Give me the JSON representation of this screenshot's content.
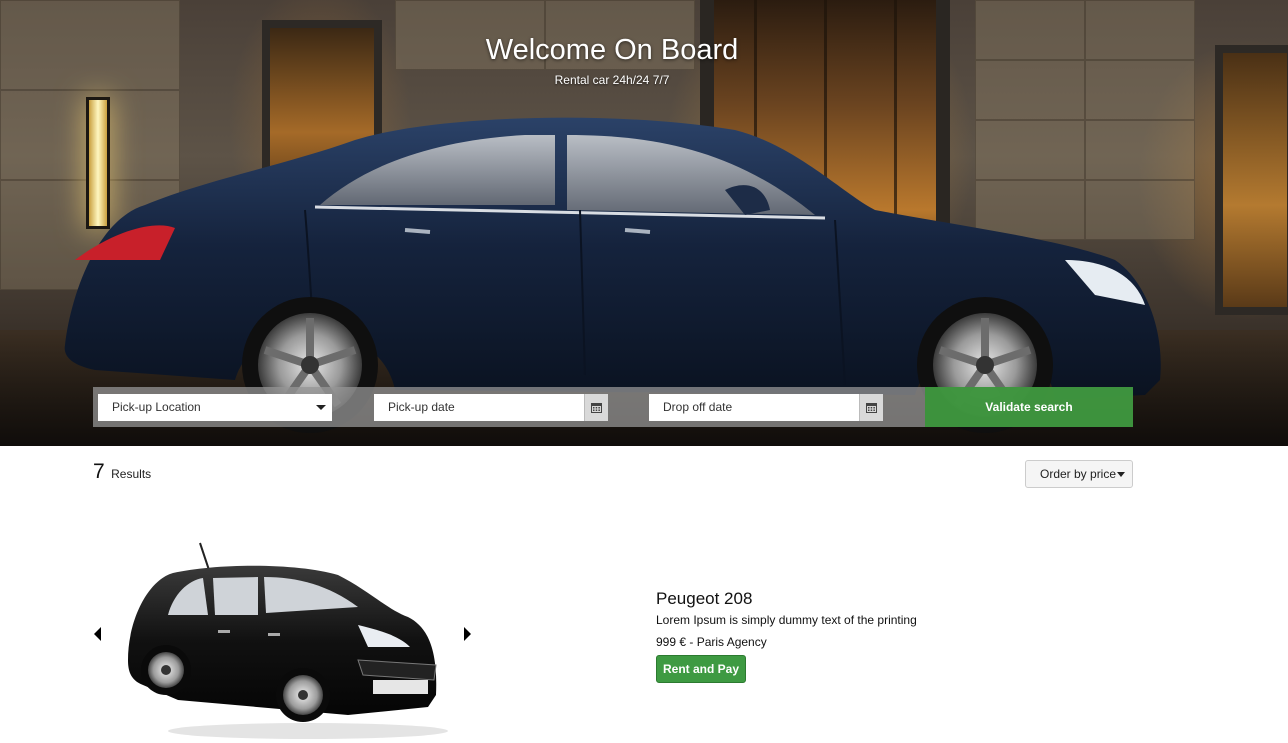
{
  "hero": {
    "title": "Welcome On Board",
    "subtitle": "Rental car 24h/24 7/7"
  },
  "search": {
    "pickup_location": "Pick-up Location",
    "pickup_date": "Pick-up date",
    "dropoff_date": "Drop off date",
    "validate_label": "Validate search"
  },
  "results": {
    "count": "7",
    "label": "Results",
    "order_label": "Order by price"
  },
  "listing": {
    "name": "Peugeot 208",
    "description": "Lorem Ipsum is simply dummy text of the printing",
    "price_agency": "999 € - Paris Agency",
    "rent_label": "Rent and Pay"
  },
  "icons": {
    "calendar": "calendar-icon",
    "caret": "chevron-down-icon",
    "prev": "arrow-left-icon",
    "next": "arrow-right-icon"
  },
  "colors": {
    "accent_green": "#3e9a42",
    "search_bar": "#969696",
    "car_blue": "#15233d"
  }
}
